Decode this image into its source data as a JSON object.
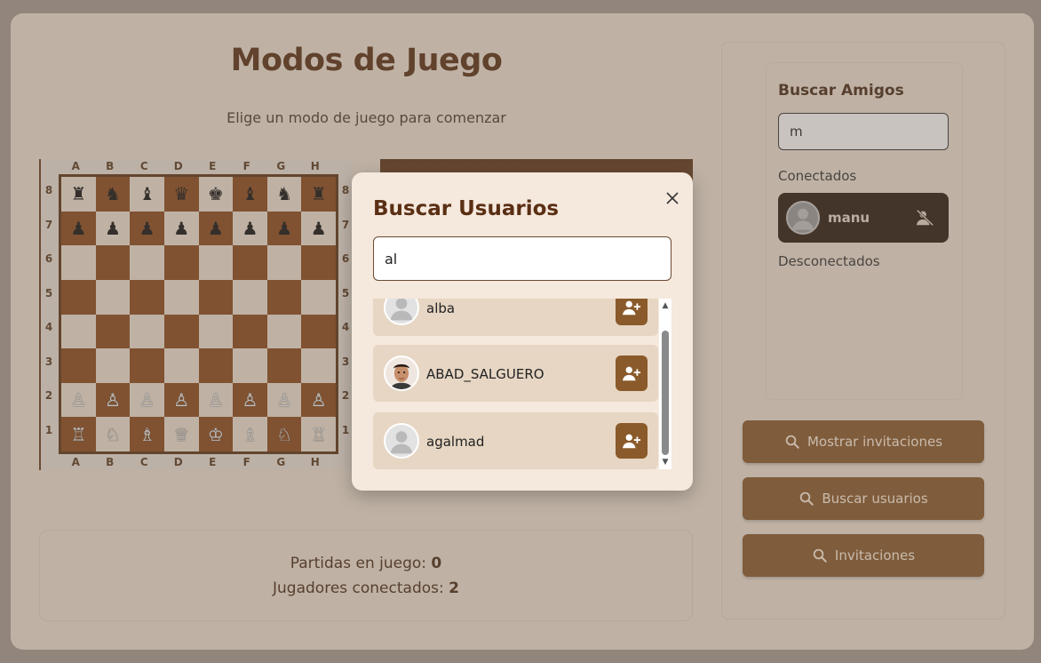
{
  "main": {
    "title": "Modos de Juego",
    "subtitle": "Elige un modo de juego para comenzar",
    "board": {
      "files": [
        "A",
        "B",
        "C",
        "D",
        "E",
        "F",
        "G",
        "H"
      ],
      "ranks": [
        "8",
        "7",
        "6",
        "5",
        "4",
        "3",
        "2",
        "1"
      ],
      "rows": [
        [
          "♜",
          "♞",
          "♝",
          "♛",
          "♚",
          "♝",
          "♞",
          "♜"
        ],
        [
          "♟",
          "♟",
          "♟",
          "♟",
          "♟",
          "♟",
          "♟",
          "♟"
        ],
        [
          "",
          "",
          "",
          "",
          "",
          "",
          "",
          ""
        ],
        [
          "",
          "",
          "",
          "",
          "",
          "",
          "",
          ""
        ],
        [
          "",
          "",
          "",
          "",
          "",
          "",
          "",
          ""
        ],
        [
          "",
          "",
          "",
          "",
          "",
          "",
          "",
          ""
        ],
        [
          "♙",
          "♙",
          "♙",
          "♙",
          "♙",
          "♙",
          "♙",
          "♙"
        ],
        [
          "♖",
          "♘",
          "♗",
          "♕",
          "♔",
          "♗",
          "♘",
          "♖"
        ]
      ]
    },
    "stats": {
      "games_label": "Partidas en juego:",
      "games_value": "0",
      "players_label": "Jugadores conectados:",
      "players_value": "2"
    }
  },
  "sidebar": {
    "friends_title": "Buscar Amigos",
    "friends_search_value": "m",
    "connected_label": "Conectados",
    "disconnected_label": "Desconectados",
    "connected_friends": [
      {
        "name": "manu",
        "action_icon": "remove-friend-icon"
      }
    ],
    "buttons": [
      {
        "label": "Mostrar invitaciones",
        "icon": "search-icon"
      },
      {
        "label": "Buscar usuarios",
        "icon": "search-icon"
      },
      {
        "label": "Invitaciones",
        "icon": "search-icon"
      }
    ]
  },
  "modal": {
    "title": "Buscar Usuarios",
    "search_value": "al",
    "results": [
      {
        "name": "alba",
        "avatar": "default-avatar"
      },
      {
        "name": "ABAD_SALGUERO",
        "avatar": "photo-avatar"
      },
      {
        "name": "agalmad",
        "avatar": "default-avatar"
      }
    ]
  },
  "colors": {
    "accent_brown": "#8a5a2b",
    "title_brown": "#5a2f14",
    "panel_bg": "#f1e4d6",
    "dark_square": "#8b4a1b",
    "light_square": "#f0e4d3"
  }
}
